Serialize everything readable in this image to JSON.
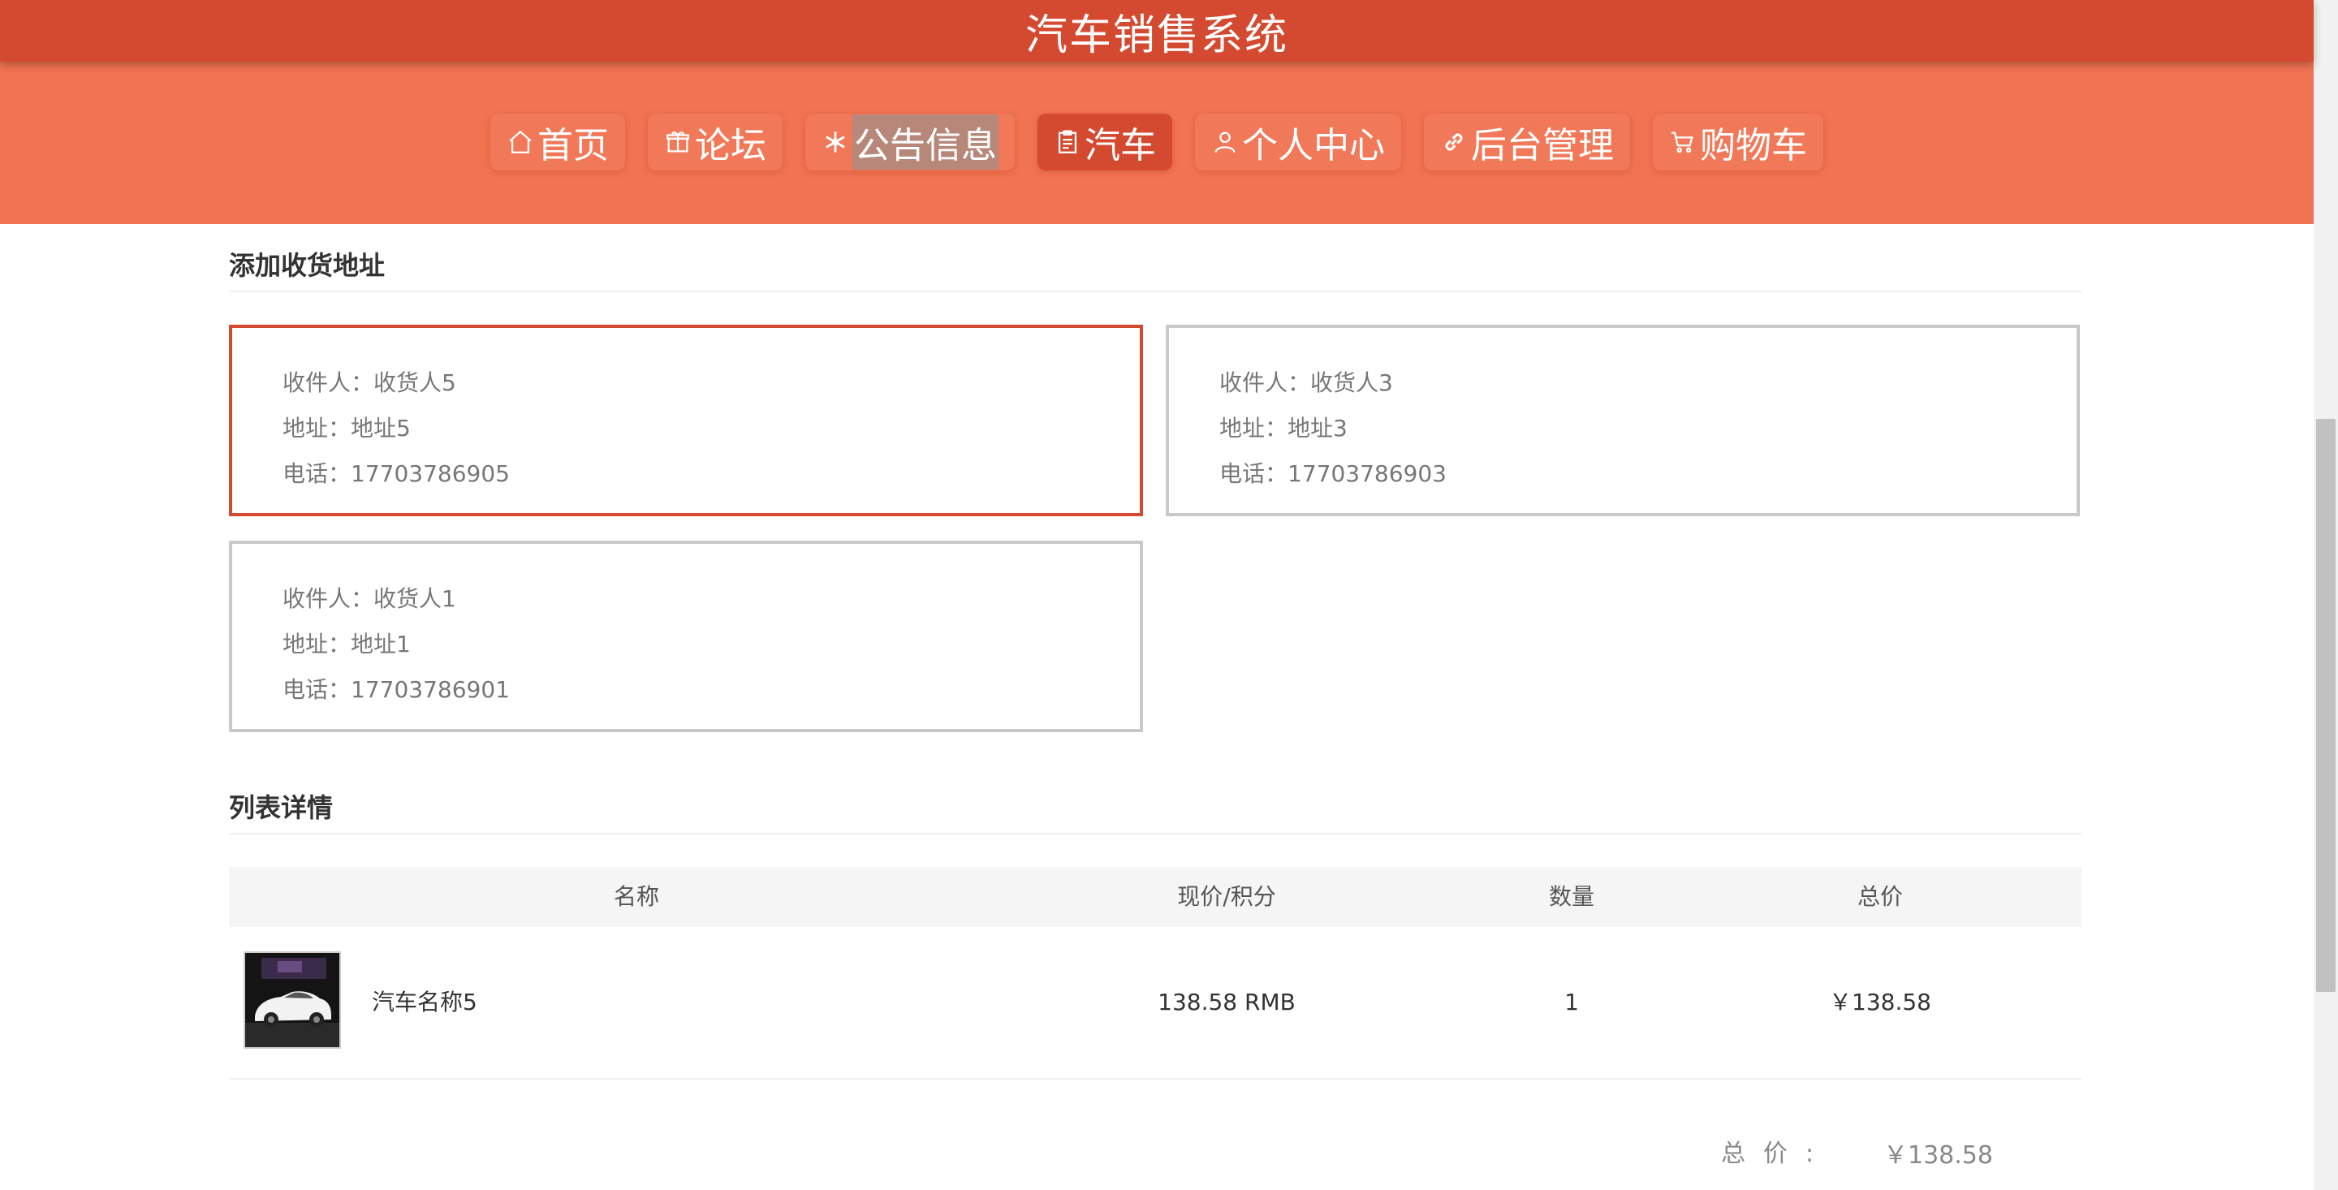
{
  "app": {
    "title": "汽车销售系统"
  },
  "colors": {
    "header": "#d44a30",
    "nav_band": "#f17352",
    "accent": "#d44a30"
  },
  "nav": [
    {
      "label": "首页",
      "icon": "home-icon"
    },
    {
      "label": "论坛",
      "icon": "gift-icon"
    },
    {
      "label": "公告信息",
      "icon": "snowflake-icon"
    },
    {
      "label": "汽车",
      "icon": "clipboard-icon",
      "active": true
    },
    {
      "label": "个人中心",
      "icon": "user-icon"
    },
    {
      "label": "后台管理",
      "icon": "link-icon"
    },
    {
      "label": "购物车",
      "icon": "cart-icon"
    }
  ],
  "address_section": {
    "title": "添加收货地址"
  },
  "addresses": [
    {
      "recipient": "收件人：收货人5",
      "address": "地址：地址5",
      "phone": "电话：17703786905",
      "selected": true
    },
    {
      "recipient": "收件人：收货人3",
      "address": "地址：地址3",
      "phone": "电话：17703786903",
      "selected": false
    },
    {
      "recipient": "收件人：收货人1",
      "address": "地址：地址1",
      "phone": "电话：17703786901",
      "selected": false
    }
  ],
  "list_section": {
    "title": "列表详情"
  },
  "table": {
    "headers": {
      "name": "名称",
      "price": "现价/积分",
      "qty": "数量",
      "total": "总价"
    },
    "rows": [
      {
        "name": "汽车名称5",
        "price": "138.58 RMB",
        "qty": "1",
        "total": "￥138.58",
        "image": "car-thumbnail"
      }
    ]
  },
  "summary": {
    "label": "总价:",
    "value": "￥138.58"
  }
}
